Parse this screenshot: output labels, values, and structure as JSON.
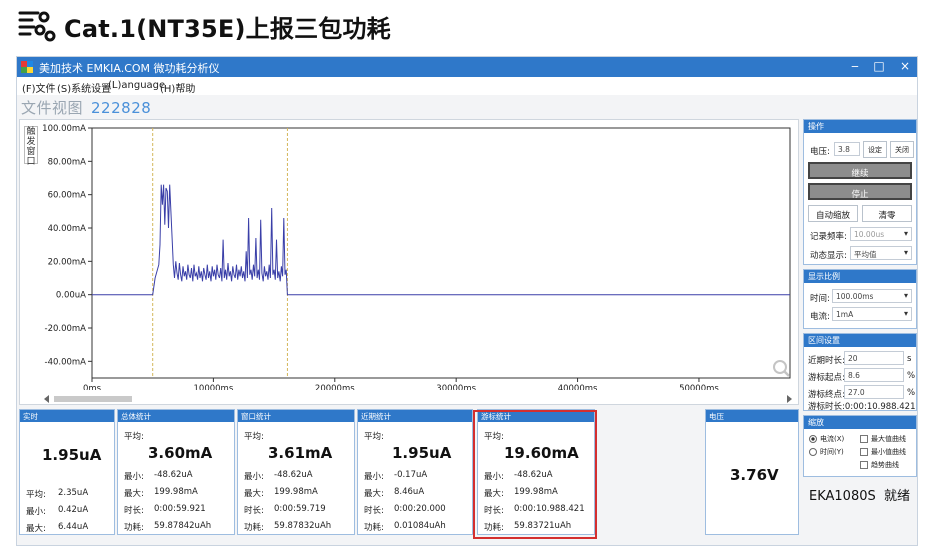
{
  "slide": {
    "title": "Cat.1(NT35E)上报三包功耗",
    "logo_icon": "sliders-network-icon"
  },
  "window": {
    "title": "美加技术 EMKIA.COM 微功耗分析仪",
    "buttons": {
      "minimize": "‒",
      "restore": "□",
      "close": "×"
    },
    "menu": [
      "(F)文件",
      "(S)系统设置",
      "(L)anguage",
      "(H)帮助"
    ]
  },
  "file_view": {
    "label": "文件视图",
    "id": "222828"
  },
  "side_tab": "触发窗口",
  "chart_data": {
    "type": "line",
    "title": "",
    "xlabel": "",
    "ylabel": "",
    "y_ticks": [
      "100.00mA",
      "80.00mA",
      "60.00mA",
      "40.00mA",
      "20.00mA",
      "0.00uA",
      "-20.00mA",
      "-40.00mA"
    ],
    "y_tick_values": [
      100,
      80,
      60,
      40,
      20,
      0,
      -20,
      -40
    ],
    "x_ticks": [
      "0ms",
      "10000ms",
      "20000ms",
      "30000ms",
      "40000ms",
      "50000ms"
    ],
    "x_tick_values": [
      0,
      10000,
      20000,
      30000,
      40000,
      50000
    ],
    "xlim": [
      0,
      57500
    ],
    "ylim": [
      -50,
      100
    ],
    "cursors_x": [
      5000,
      16100
    ],
    "line_color": "#3a3fa8",
    "cursor_color": "#d4b75a",
    "series": [
      {
        "x": [
          0,
          5000,
          5200,
          5500,
          5600,
          5700,
          5800,
          5900,
          6000,
          6100,
          6200,
          6300,
          6400,
          6500,
          6600,
          6700,
          6800,
          6900,
          7000,
          7100,
          7200,
          7300,
          7400,
          7500,
          7600,
          7700,
          7800,
          7900,
          8000,
          8100,
          8200,
          8300,
          8400,
          8500,
          8600,
          8700,
          8800,
          8900,
          9000,
          9100,
          9200,
          9300,
          9400,
          9500,
          9600,
          9700,
          9800,
          9900,
          10000,
          10100,
          10200,
          10300,
          10400,
          10500,
          10600,
          10700,
          10800,
          10900,
          11000,
          11100,
          11200,
          11300,
          11400,
          11500,
          11600,
          11700,
          11800,
          11900,
          12000,
          12100,
          12200,
          12300,
          12400,
          12500,
          12600,
          12700,
          12800,
          12900,
          13000,
          13100,
          13200,
          13300,
          13400,
          13500,
          13600,
          13700,
          13800,
          13900,
          14000,
          14100,
          14200,
          14300,
          14400,
          14500,
          14600,
          14700,
          14800,
          14900,
          15000,
          15100,
          15200,
          15300,
          15400,
          15500,
          15600,
          15700,
          15800,
          15900,
          16000,
          16100,
          16200,
          57500
        ],
        "y": [
          0,
          0,
          10,
          18,
          30,
          66,
          54,
          66,
          42,
          64,
          62,
          40,
          66,
          50,
          34,
          18,
          10,
          20,
          13,
          9,
          19,
          12,
          8,
          17,
          11,
          14,
          9,
          18,
          12,
          10,
          16,
          8,
          18,
          11,
          13,
          9,
          17,
          10,
          14,
          8,
          16,
          12,
          9,
          18,
          10,
          14,
          8,
          17,
          11,
          15,
          9,
          18,
          12,
          10,
          16,
          8,
          33,
          10,
          15,
          9,
          19,
          11,
          14,
          8,
          17,
          12,
          10,
          18,
          9,
          15,
          11,
          17,
          10,
          14,
          8,
          26,
          10,
          46,
          12,
          15,
          9,
          18,
          11,
          34,
          10,
          15,
          9,
          45,
          13,
          8,
          17,
          11,
          14,
          9,
          18,
          10,
          52,
          12,
          15,
          9,
          33,
          10,
          14,
          8,
          17,
          11,
          46,
          12,
          15,
          0,
          0,
          0
        ]
      }
    ]
  },
  "right_panel": {
    "operate": {
      "header": "操作",
      "voltage_label": "电压:",
      "voltage_value": "3.8",
      "set_label": "设定",
      "off_label": "关闭",
      "continue_label": "继续",
      "stop_label": "停止",
      "autoscale_label": "自动缩放",
      "clear_label": "清零",
      "rate_label": "记录频率:",
      "rate_value": "10.00us",
      "display_label": "动态显示:",
      "display_value": "平均值"
    },
    "scale": {
      "header": "显示比例",
      "time_label": "时间:",
      "time_value": "100.00ms",
      "current_label": "电流:",
      "current_value": "1mA"
    },
    "interval": {
      "header": "区间设置",
      "recent_label": "近期时长:",
      "recent_value": "20",
      "recent_unit": "s",
      "start_label": "游标起点:",
      "start_value": "8.6",
      "start_unit": "%",
      "end_label": "游标终点:",
      "end_value": "27.0",
      "end_unit": "%",
      "duration_text": "游标时长:0:00:10.988.421"
    },
    "zoom": {
      "header": "缩放",
      "radio_current": "电流(X)",
      "radio_time": "时间(Y)",
      "check_max_current": "最大值曲线",
      "check_min_current": "最小值曲线",
      "check_trend": "趋势曲线"
    }
  },
  "stats": {
    "realtime": {
      "header": "实时",
      "value": "1.95uA",
      "avg_label": "平均:",
      "avg": "2.35uA",
      "min_label": "最小:",
      "min": "0.42uA",
      "max_label": "最大:",
      "max": "6.44uA"
    },
    "total": {
      "header": "总体统计",
      "avg_label": "平均:",
      "avg": "3.60mA",
      "min_label": "最小:",
      "min": "-48.62uA",
      "max_label": "最大:",
      "max": "199.98mA",
      "dur_label": "时长:",
      "dur": "0:00:59.921",
      "energy_label": "功耗:",
      "energy": "59.87842uAh"
    },
    "window": {
      "header": "窗口统计",
      "avg_label": "平均:",
      "avg": "3.61mA",
      "min_label": "最小:",
      "min": "-48.62uA",
      "max_label": "最大:",
      "max": "199.98mA",
      "dur_label": "时长:",
      "dur": "0:00:59.719",
      "energy_label": "功耗:",
      "energy": "59.87832uAh"
    },
    "recent": {
      "header": "近期统计",
      "avg_label": "平均:",
      "avg": "1.95uA",
      "min_label": "最小:",
      "min": "-0.17uA",
      "max_label": "最大:",
      "max": "8.46uA",
      "dur_label": "时长:",
      "dur": "0:00:20.000",
      "energy_label": "功耗:",
      "energy": "0.01084uAh"
    },
    "cursor": {
      "header": "游标统计",
      "avg_label": "平均:",
      "avg": "19.60mA",
      "min_label": "最小:",
      "min": "-48.62uA",
      "max_label": "最大:",
      "max": "199.98mA",
      "dur_label": "时长:",
      "dur": "0:00:10.988.421",
      "energy_label": "功耗:",
      "energy": "59.83721uAh"
    },
    "voltage": {
      "header": "电压",
      "value": "3.76V"
    }
  },
  "device": {
    "model": "EKA1080S",
    "status": "就绪"
  },
  "colors": {
    "accent": "#2f78c9",
    "highlight": "#d32f2f"
  }
}
